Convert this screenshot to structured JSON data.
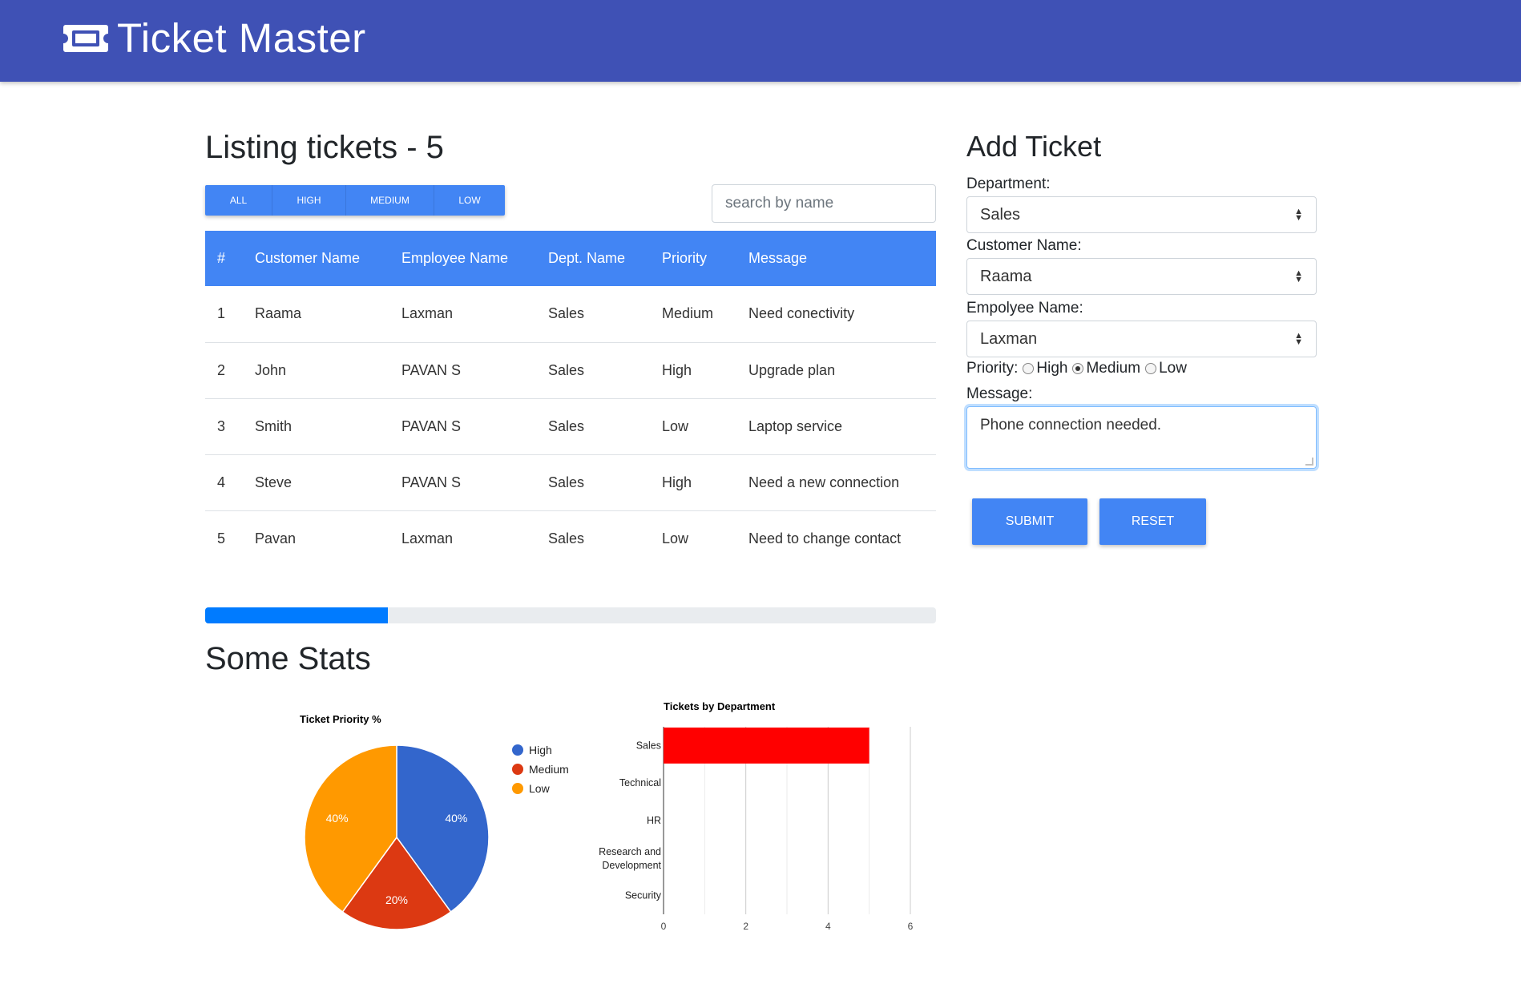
{
  "app": {
    "title": "Ticket Master",
    "icon": "ticket-icon"
  },
  "listing": {
    "title": "Listing tickets - 5",
    "filters": [
      "ALL",
      "HIGH",
      "MEDIUM",
      "LOW"
    ],
    "search_placeholder": "search by name",
    "columns": [
      "#",
      "Customer Name",
      "Employee Name",
      "Dept. Name",
      "Priority",
      "Message"
    ],
    "rows": [
      [
        "1",
        "Raama",
        "Laxman",
        "Sales",
        "Medium",
        "Need conectivity"
      ],
      [
        "2",
        "John",
        "PAVAN S",
        "Sales",
        "High",
        "Upgrade plan"
      ],
      [
        "3",
        "Smith",
        "PAVAN S",
        "Sales",
        "Low",
        "Laptop service"
      ],
      [
        "4",
        "Steve",
        "PAVAN S",
        "Sales",
        "High",
        "Need a new connection"
      ],
      [
        "5",
        "Pavan",
        "Laxman",
        "Sales",
        "Low",
        "Need to change contact"
      ]
    ],
    "progress_fraction": 0.25
  },
  "stats": {
    "title": "Some Stats"
  },
  "form": {
    "title": "Add Ticket",
    "department_label": "Department:",
    "department_value": "Sales",
    "customer_label": "Customer Name:",
    "customer_value": "Raama",
    "employee_label": "Empolyee Name:",
    "employee_value": "Laxman",
    "priority_label": "Priority:",
    "priority_options": [
      "High",
      "Medium",
      "Low"
    ],
    "priority_selected": "Medium",
    "message_label": "Message:",
    "message_value": "Phone connection needed.",
    "submit_label": "SUBMIT",
    "reset_label": "RESET"
  },
  "chart_data": [
    {
      "type": "pie",
      "title": "Ticket Priority %",
      "categories": [
        "High",
        "Medium",
        "Low"
      ],
      "values": [
        40,
        20,
        40
      ],
      "labels": [
        "40%",
        "20%",
        "40%"
      ],
      "colors": [
        "#3366cc",
        "#dc3912",
        "#ff9900"
      ],
      "legend": "right"
    },
    {
      "type": "bar",
      "orientation": "horizontal",
      "title": "Tickets by Department",
      "categories": [
        "Sales",
        "Technical",
        "HR",
        "Research and Development",
        "Security"
      ],
      "values": [
        5,
        0,
        0,
        0,
        0
      ],
      "xticks": [
        "0",
        "2",
        "4",
        "6"
      ],
      "xlim": [
        0,
        6
      ],
      "color": "#ff0000",
      "grid": true
    }
  ]
}
